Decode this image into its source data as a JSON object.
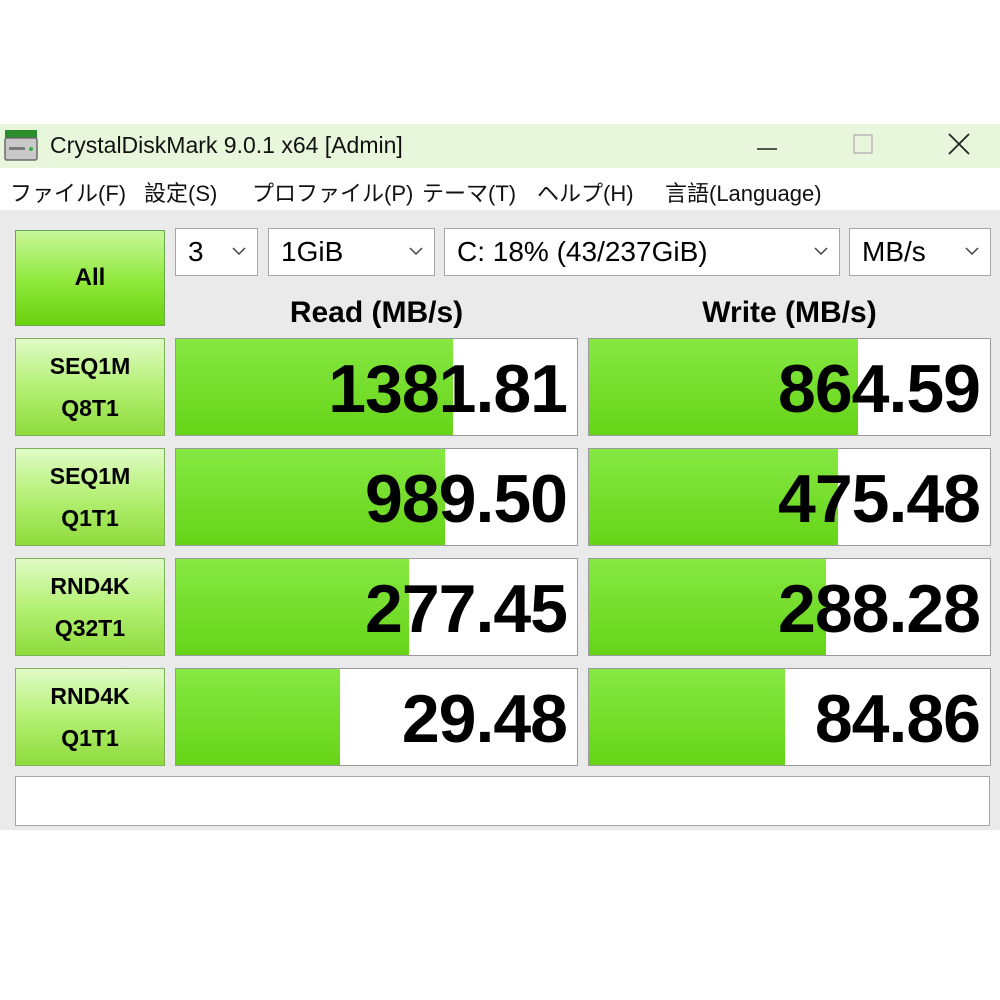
{
  "window": {
    "title": "CrystalDiskMark 9.0.1 x64 [Admin]"
  },
  "menu": [
    "ファイル(F)",
    "設定(S)",
    "プロファイル(P)",
    "テーマ(T)",
    "ヘルプ(H)",
    "言語(Language)"
  ],
  "controls": {
    "all_label": "All",
    "count": "3",
    "size": "1GiB",
    "drive": "C: 18% (43/237GiB)",
    "unit": "MB/s"
  },
  "headers": {
    "read": "Read (MB/s)",
    "write": "Write (MB/s)"
  },
  "rows": [
    {
      "line1": "SEQ1M",
      "line2": "Q8T1",
      "read": "1381.81",
      "write": "864.59",
      "read_fill": 0.69,
      "write_fill": 0.67
    },
    {
      "line1": "SEQ1M",
      "line2": "Q1T1",
      "read": "989.50",
      "write": "475.48",
      "read_fill": 0.67,
      "write_fill": 0.62
    },
    {
      "line1": "RND4K",
      "line2": "Q32T1",
      "read": "277.45",
      "write": "288.28",
      "read_fill": 0.58,
      "write_fill": 0.59
    },
    {
      "line1": "RND4K",
      "line2": "Q1T1",
      "read": "29.48",
      "write": "84.86",
      "read_fill": 0.41,
      "write_fill": 0.49
    }
  ],
  "status": "",
  "colors": {
    "accent": "#66d418",
    "titlebar": "#e8f7dc",
    "panel": "#eaeaea"
  }
}
